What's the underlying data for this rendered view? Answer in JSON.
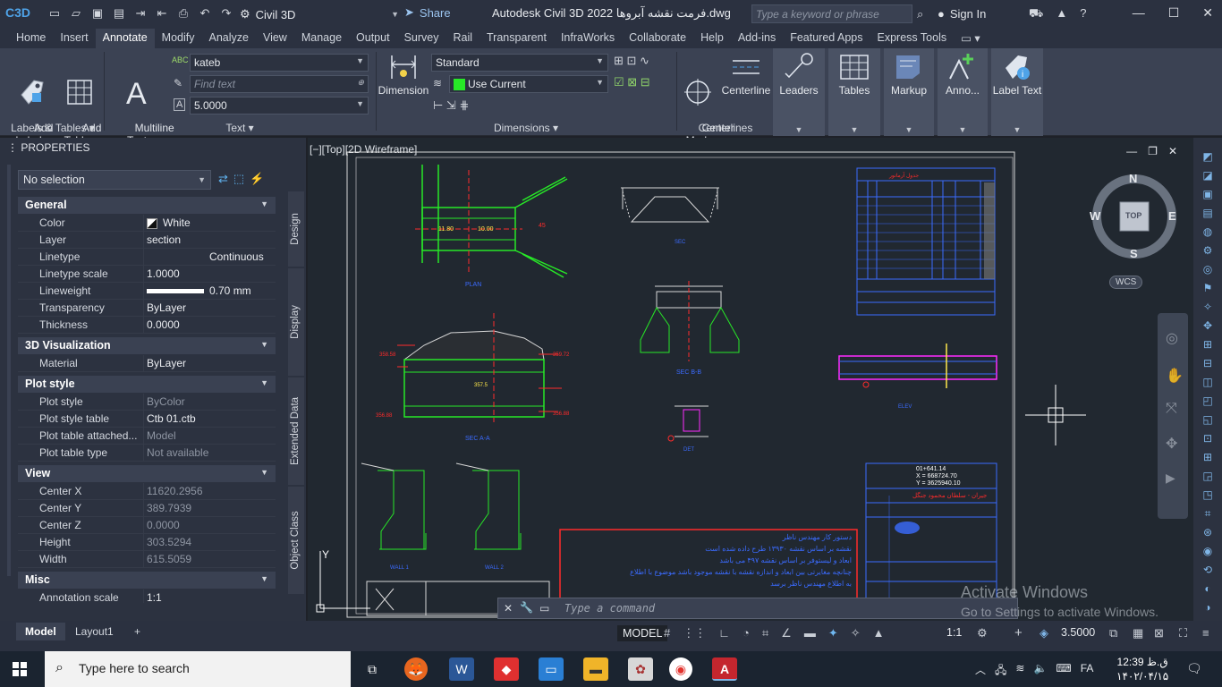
{
  "titlebar": {
    "app_badge": "C3D",
    "workspace": "Civil 3D",
    "share": "Share",
    "title": "Autodesk Civil 3D 2022  فرمت نقشه آبروها.dwg",
    "search_placeholder": "Type a keyword or phrase",
    "signin": "Sign In"
  },
  "tabs": [
    "Home",
    "Insert",
    "Annotate",
    "Modify",
    "Analyze",
    "View",
    "Manage",
    "Output",
    "Survey",
    "Rail",
    "Transparent",
    "InfraWorks",
    "Collaborate",
    "Help",
    "Add-ins",
    "Featured Apps",
    "Express Tools"
  ],
  "ribbon": {
    "add_labels": "Add\nLabels",
    "add_tables": "Add\nTables",
    "labels_tables_panel": "Labels & Tables",
    "multiline": "Multiline\nText",
    "text_style": "kateb",
    "find_text": "Find text",
    "text_height": "5.0000",
    "text_panel": "Text",
    "dimension": "Dimension",
    "dim_style": "Standard",
    "dim_layer": "Use Current",
    "dimensions_panel": "Dimensions",
    "center_mark": "Center\nMark",
    "centerline": "Centerline",
    "centerlines_panel": "Centerlines",
    "leaders": "Leaders",
    "tables": "Tables",
    "markup": "Markup",
    "anno": "Anno...",
    "label_text": "Label Text"
  },
  "properties": {
    "header": "PROPERTIES",
    "selection": "No selection",
    "sections": [
      {
        "title": "General",
        "rows": [
          {
            "k": "Color",
            "v": "White"
          },
          {
            "k": "Layer",
            "v": "section"
          },
          {
            "k": "Linetype",
            "v": "Continuous"
          },
          {
            "k": "Linetype scale",
            "v": "1.0000"
          },
          {
            "k": "Lineweight",
            "v": "0.70 mm"
          },
          {
            "k": "Transparency",
            "v": "ByLayer"
          },
          {
            "k": "Thickness",
            "v": "0.0000"
          }
        ]
      },
      {
        "title": "3D Visualization",
        "rows": [
          {
            "k": "Material",
            "v": "ByLayer"
          }
        ]
      },
      {
        "title": "Plot style",
        "rows": [
          {
            "k": "Plot style",
            "v": "ByColor"
          },
          {
            "k": "Plot style table",
            "v": "Ctb 01.ctb"
          },
          {
            "k": "Plot table attached...",
            "v": "Model"
          },
          {
            "k": "Plot table type",
            "v": "Not available"
          }
        ]
      },
      {
        "title": "View",
        "rows": [
          {
            "k": "Center X",
            "v": "11620.2956"
          },
          {
            "k": "Center Y",
            "v": "389.7939"
          },
          {
            "k": "Center Z",
            "v": "0.0000"
          },
          {
            "k": "Height",
            "v": "303.5294"
          },
          {
            "k": "Width",
            "v": "615.5059"
          }
        ]
      },
      {
        "title": "Misc",
        "rows": [
          {
            "k": "Annotation scale",
            "v": "1:1"
          },
          {
            "k": "UCS icon On",
            "v": "Yes"
          }
        ]
      }
    ],
    "vtabs": [
      "Design",
      "Display",
      "Extended Data",
      "Object Class"
    ]
  },
  "viewport": {
    "label": "[−][Top][2D Wireframe]",
    "compass": {
      "n": "N",
      "s": "S",
      "e": "E",
      "w": "W",
      "top": "TOP"
    },
    "wcs": "WCS",
    "command_placeholder": "Type a command",
    "activate1": "Activate Windows",
    "activate2": "Go to Settings to activate Windows."
  },
  "drawing_text": {
    "red_note_title": "دستور کار مهندس ناظر",
    "red_note_1": "نقشه بر اساس نقشه ۱۳۹۳۰ طرح داده شده است",
    "red_note_2": "ابعاد و لیستوفر بر اساس نقشه ۴۹۷ می باشد",
    "red_note_3": "چنانچه مغایرتی بین ابعاد و اندازه نقشه با نقشه موجود باشد موضوع با اطلاع",
    "red_note_4": "به اطلاع مهندس ناظر برسد",
    "tb_coords": "01+641.14\nX = 668724.70\nY = 3625940.10",
    "tb_title": "جیران - سلطان محمود جنگل"
  },
  "layout_tabs": [
    "Model",
    "Layout1"
  ],
  "statusbar": {
    "model": "MODEL",
    "scale": "1:1",
    "lineweight": "3.5000"
  },
  "taskbar": {
    "search": "Type here to search",
    "lang": "FA",
    "time": "12:39 ق.ظ",
    "date": "۱۴۰۲/۰۴/۱۵"
  },
  "colors": {
    "accent": "#4fa3e8",
    "red": "#ff2b2b",
    "green": "#27e827",
    "cyan": "#2ee0e6",
    "magenta": "#ff2bff",
    "blue": "#3b6bff",
    "yellow": "#ffe94a"
  }
}
